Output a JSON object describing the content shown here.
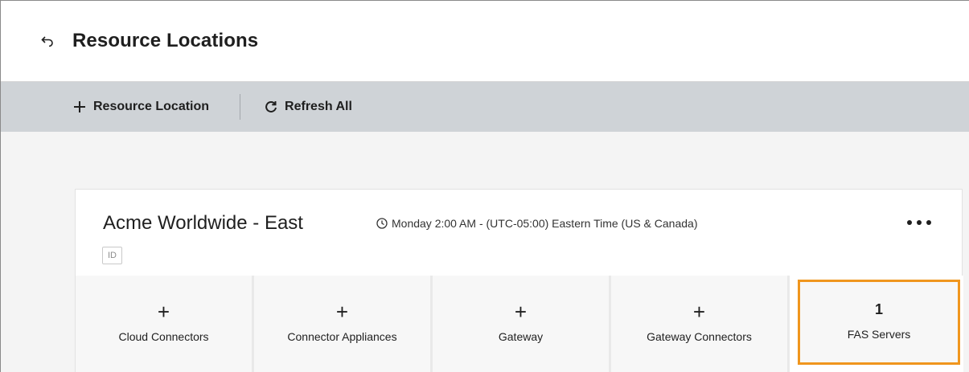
{
  "header": {
    "title": "Resource Locations",
    "back_icon": "back-arrow-icon"
  },
  "toolbar": {
    "add_label": "Resource Location",
    "refresh_label": "Refresh All",
    "add_icon": "plus-icon",
    "refresh_icon": "refresh-icon"
  },
  "location": {
    "name": "Acme Worldwide - East",
    "maintenance": "Monday 2:00 AM - (UTC-05:00) Eastern Time (US & Canada)",
    "id_badge": "ID",
    "tiles": [
      {
        "value": "+",
        "label": "Cloud Connectors"
      },
      {
        "value": "+",
        "label": "Connector Appliances"
      },
      {
        "value": "+",
        "label": "Gateway"
      },
      {
        "value": "+",
        "label": "Gateway Connectors"
      },
      {
        "value": "1",
        "label": "FAS Servers"
      }
    ]
  },
  "colors": {
    "toolbar_bg": "#cfd3d7",
    "highlight": "#f0961e"
  }
}
